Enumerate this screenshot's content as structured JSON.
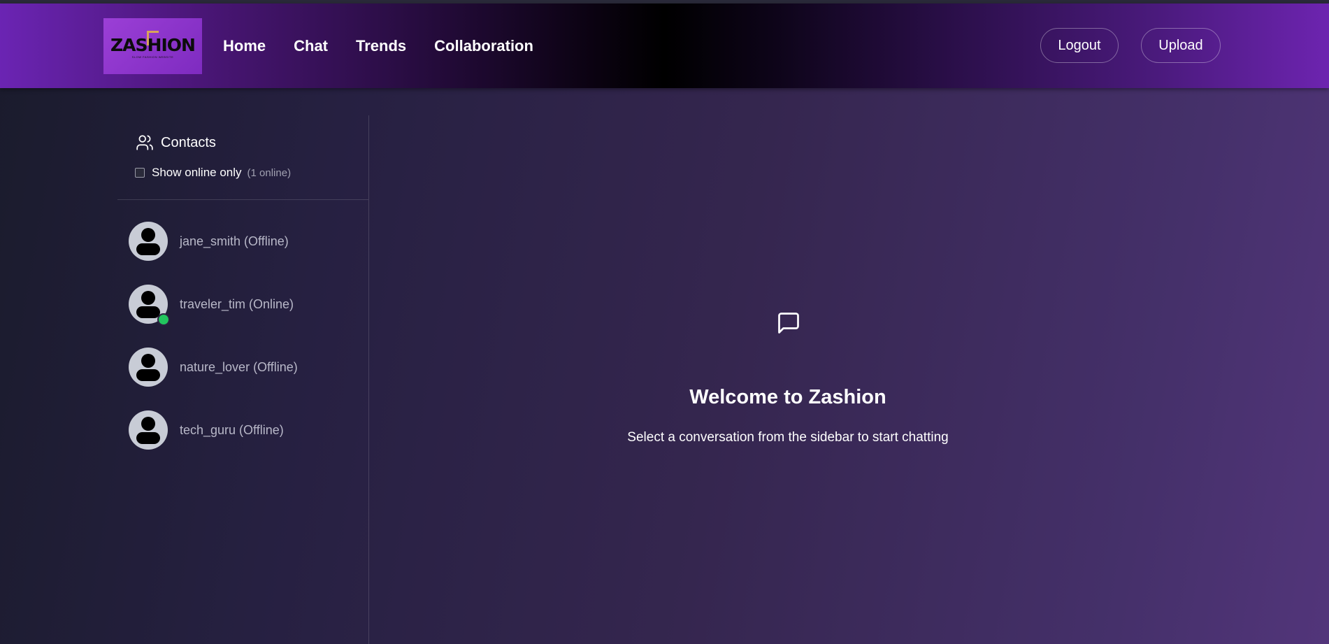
{
  "app": {
    "logo_text": "ZASHION",
    "logo_subtext": "SLOW FASHION WEBSITE"
  },
  "nav": {
    "items": [
      "Home",
      "Chat",
      "Trends",
      "Collaboration"
    ]
  },
  "header": {
    "logout_label": "Logout",
    "upload_label": "Upload"
  },
  "sidebar": {
    "title": "Contacts",
    "filter_label": "Show online only",
    "online_count": "(1 online)",
    "filter_checked": false,
    "contacts": [
      {
        "name": "jane_smith (Offline)",
        "online": false
      },
      {
        "name": "traveler_tim (Online)",
        "online": true
      },
      {
        "name": "nature_lover (Offline)",
        "online": false
      },
      {
        "name": "tech_guru (Offline)",
        "online": false
      }
    ]
  },
  "main": {
    "welcome_title": "Welcome to Zashion",
    "welcome_subtitle": "Select a conversation from the sidebar to start chatting",
    "icon": "chat-bubble-icon"
  },
  "colors": {
    "online_dot": "#22c55e",
    "header_accent": "#6b24b3"
  }
}
